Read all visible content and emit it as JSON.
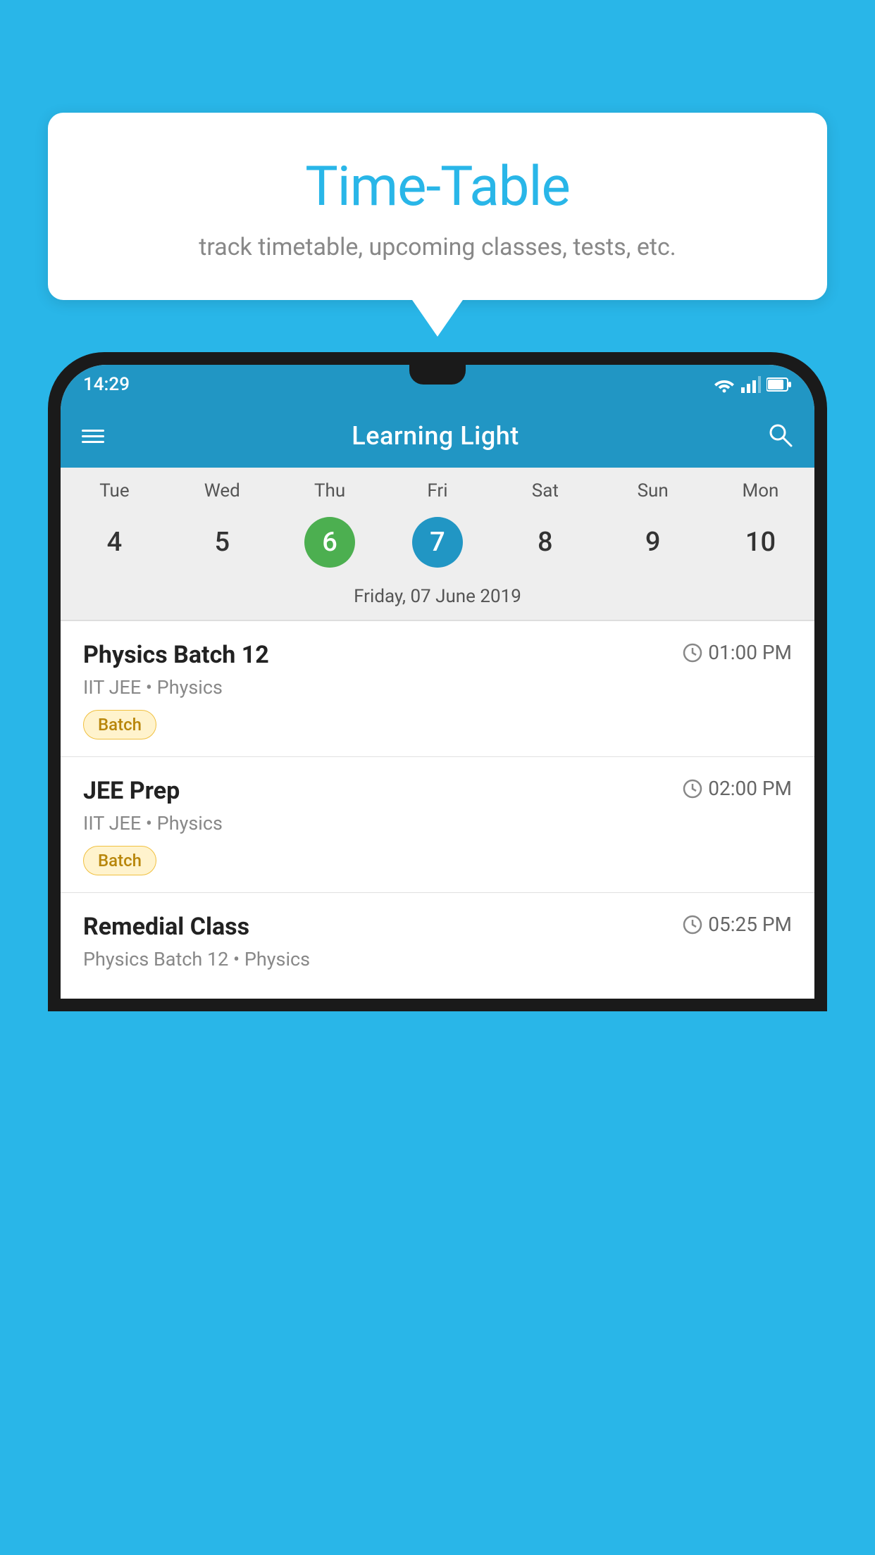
{
  "background_color": "#29b6e8",
  "speech_bubble": {
    "title": "Time-Table",
    "subtitle": "track timetable, upcoming classes, tests, etc."
  },
  "phone": {
    "status_bar": {
      "time": "14:29"
    },
    "app_bar": {
      "title": "Learning Light"
    },
    "calendar": {
      "days": [
        "Tue",
        "Wed",
        "Thu",
        "Fri",
        "Sat",
        "Sun",
        "Mon"
      ],
      "dates": [
        "4",
        "5",
        "6",
        "7",
        "8",
        "9",
        "10"
      ],
      "today_index": 2,
      "selected_index": 3,
      "selected_date_label": "Friday, 07 June 2019"
    },
    "schedule": [
      {
        "title": "Physics Batch 12",
        "time": "01:00 PM",
        "subtitle": "IIT JEE • Physics",
        "tag": "Batch"
      },
      {
        "title": "JEE Prep",
        "time": "02:00 PM",
        "subtitle": "IIT JEE • Physics",
        "tag": "Batch"
      },
      {
        "title": "Remedial Class",
        "time": "05:25 PM",
        "subtitle": "Physics Batch 12 • Physics",
        "tag": ""
      }
    ]
  }
}
